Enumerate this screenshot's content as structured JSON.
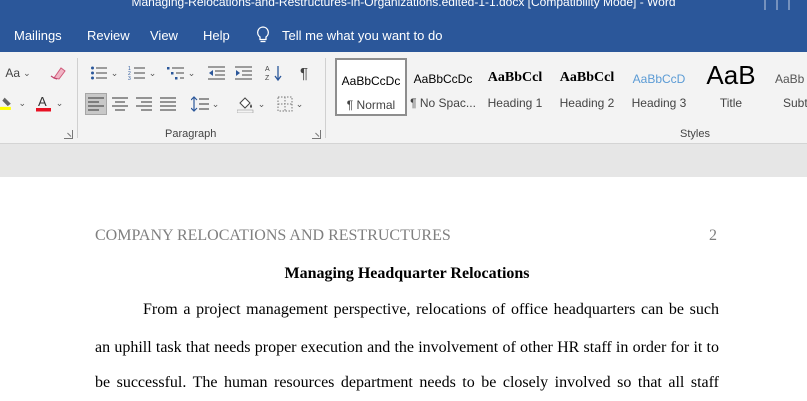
{
  "window": {
    "title": "Managing-Relocations-and-Restructures-in-Organizations.edited-1-1.docx [Compatibility Mode]  -  Word"
  },
  "menu": {
    "items": [
      "Mailings",
      "Review",
      "View",
      "Help"
    ],
    "tell_me": "Tell me what you want to do"
  },
  "ribbon": {
    "font_group": {
      "change_case": "Aa"
    },
    "paragraph_group": {
      "label": "Paragraph"
    },
    "styles_group": {
      "label": "Styles",
      "tiles": [
        {
          "preview": "AaBbCcDc",
          "name": "¶ Normal"
        },
        {
          "preview": "AaBbCcDc",
          "name": "¶ No Spac..."
        },
        {
          "preview": "AaBbCcl",
          "name": "Heading 1"
        },
        {
          "preview": "AaBbCcl",
          "name": "Heading 2"
        },
        {
          "preview": "AaBbCcD",
          "name": "Heading 3"
        },
        {
          "preview": "AaB",
          "name": "Title"
        },
        {
          "preview": "AaBb",
          "name": "Subt"
        }
      ]
    }
  },
  "colors": {
    "brand": "#2b579a",
    "highlight": "#ffff00",
    "font_color": "#e81123",
    "heading3": "#5b9bd5"
  },
  "document": {
    "running_header": "COMPANY RELOCATIONS AND RESTRUCTURES",
    "page_number": "2",
    "title": "Managing Headquarter Relocations",
    "lines": [
      "From a project management perspective, relocations of office headquarters can be such",
      "an uphill task that needs proper execution and the involvement of other HR staff in order for it to",
      "be successful. The human resources department needs to be closely involved so that all staff"
    ]
  }
}
